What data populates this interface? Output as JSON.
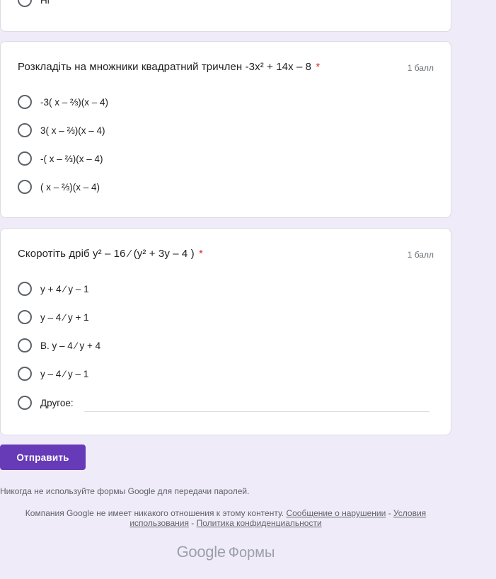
{
  "top_card": {
    "partial_option_label": "Ні"
  },
  "question1": {
    "title": "Розкладіть на множники квадратний тричлен -3x² + 14x – 8",
    "required_marker": "*",
    "points": "1 балл",
    "options": [
      "-3( x – ⅔)(x – 4)",
      "3( x – ⅔)(x – 4)",
      "-( x – ⅔)(x – 4)",
      "( x – ⅔)(x – 4)"
    ]
  },
  "question2": {
    "title": "Скоротіть дріб y² – 16 ⁄ (y² + 3y – 4 )",
    "required_marker": "*",
    "points": "1 балл",
    "options": [
      "y + 4 ⁄ y – 1",
      "y – 4 ⁄ y + 1",
      "B. y – 4 ⁄ y + 4",
      "y – 4 ⁄ y – 1"
    ],
    "other_label": "Другое:",
    "other_value": ""
  },
  "submit_label": "Отправить",
  "footer": {
    "password_warning": "Никогда не используйте формы Google для передачи паролей.",
    "disclaimer_text": "Компания Google не имеет никакого отношения к этому контенту.",
    "report_link": "Сообщение о нарушении",
    "separator": " - ",
    "terms_link": "Условия использования",
    "privacy_link": "Политика конфиденциальности",
    "brand_google": "Google",
    "brand_forms": "Формы"
  },
  "colors": {
    "background": "#f0ebf8",
    "accent": "#673ab7",
    "required": "#d93025"
  }
}
